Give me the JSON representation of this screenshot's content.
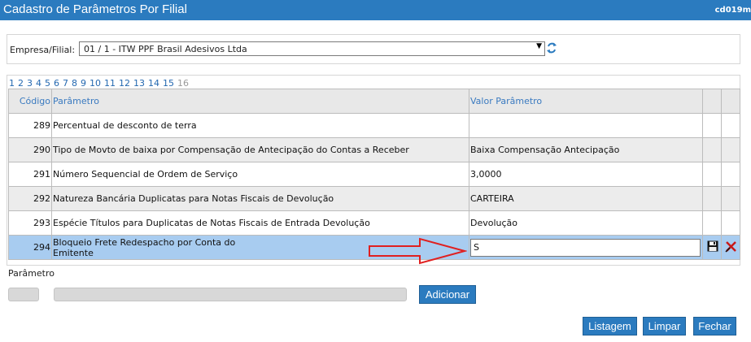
{
  "window": {
    "title": "Cadastro de Parâmetros Por Filial",
    "code": "cd019m"
  },
  "empresa": {
    "label": "Empresa/Filial:",
    "selected": "01 / 1 - ITW PPF Brasil Adesivos Ltda"
  },
  "pager": {
    "pages": [
      "1",
      "2",
      "3",
      "4",
      "5",
      "6",
      "7",
      "8",
      "9",
      "10",
      "11",
      "12",
      "13",
      "14",
      "15",
      "16"
    ],
    "current": "16"
  },
  "table": {
    "headers": {
      "code": "Código",
      "param": "Parâmetro",
      "value": "Valor Parâmetro"
    },
    "rows": [
      {
        "code": "289",
        "param": "Percentual de desconto de terra",
        "value": ""
      },
      {
        "code": "290",
        "param": "Tipo de Movto de baixa por Compensação de Antecipação do Contas a Receber",
        "value": "Baixa Compensação Antecipação"
      },
      {
        "code": "291",
        "param": "Número Sequencial de Ordem de Serviço",
        "value": "3,0000"
      },
      {
        "code": "292",
        "param": "Natureza Bancária Duplicatas para Notas Fiscais de Devolução",
        "value": "CARTEIRA"
      },
      {
        "code": "293",
        "param": "Espécie Títulos para Duplicatas de Notas Fiscais de Entrada Devolução",
        "value": "Devolução"
      }
    ],
    "editing": {
      "code": "294",
      "param_line1": "Bloqueio Frete Redespacho por Conta do",
      "param_line2": "Emitente",
      "value": "S"
    }
  },
  "form": {
    "param_label": "Parâmetro",
    "add_button": "Adicionar"
  },
  "footer": {
    "listagem": "Listagem",
    "limpar": "Limpar",
    "fechar": "Fechar"
  },
  "icons": {
    "refresh": "refresh-icon",
    "save": "floppy-disk-icon",
    "delete": "delete-x-icon",
    "annotation": "red-arrow-icon"
  },
  "colors": {
    "titlebar": "#2b7bbf",
    "selected_row": "#a8ccf0",
    "annotation": "#e02020"
  }
}
